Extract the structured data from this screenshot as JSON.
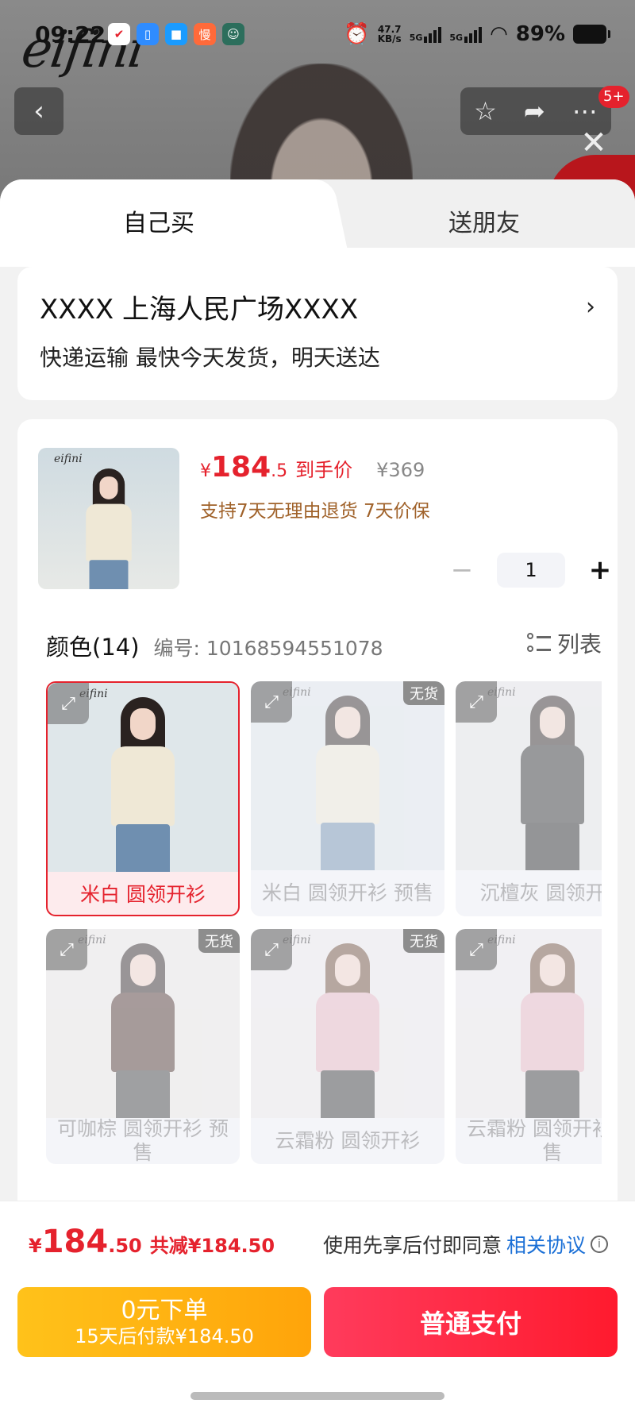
{
  "status_bar": {
    "time": "09:22",
    "net_speed_top": "47.7",
    "net_speed_bottom": "KB/s",
    "signal1": "5G",
    "signal2": "5G",
    "battery": "89%"
  },
  "background": {
    "brand": "eifini"
  },
  "nav": {
    "badge": "5+"
  },
  "tabs": {
    "self": "自己买",
    "gift": "送朋友"
  },
  "address": {
    "text": "XXXX  上海人民广场XXXX",
    "delivery": "快递运输 最快今天发货，明天送达"
  },
  "product": {
    "thumb_logo": "eifini",
    "price_symbol": "¥",
    "price_int": "184",
    "price_dec": ".5",
    "price_label": "到手价",
    "original_price": "¥369",
    "returns": "支持7天无理由退货 7天价保",
    "quantity": "1"
  },
  "colors": {
    "title": "颜色(14)",
    "code": "编号: 10168594551078",
    "list_label": "列表",
    "variants": [
      {
        "name": "米白 圆领开衫",
        "oos": "",
        "logo": "eifini"
      },
      {
        "name": "米白 圆领开衫 预售",
        "oos": "无货",
        "logo": "eifini"
      },
      {
        "name": "沉檀灰 圆领开衫",
        "oos": "",
        "logo": "eifini"
      },
      {
        "name": "可咖棕 圆领开衫 预售",
        "oos": "无货",
        "logo": "eifini"
      },
      {
        "name": "云霜粉 圆领开衫",
        "oos": "无货",
        "logo": "eifini"
      },
      {
        "name": "云霜粉 圆领开衫 预售",
        "oos": "",
        "logo": "eifini"
      }
    ]
  },
  "summary": {
    "currency": "¥",
    "price_int": "184",
    "price_dec": ".50",
    "discount": "共减¥184.50",
    "agree_text": "使用先享后付即同意",
    "agree_link": "相关协议"
  },
  "buttons": {
    "later_line1": "0元下单",
    "later_line2": "15天后付款¥184.50",
    "pay": "普通支付"
  },
  "colors_theme": {
    "accent_red": "#e5222d",
    "orange": "#ffa40a",
    "link_blue": "#1a6fd6"
  }
}
